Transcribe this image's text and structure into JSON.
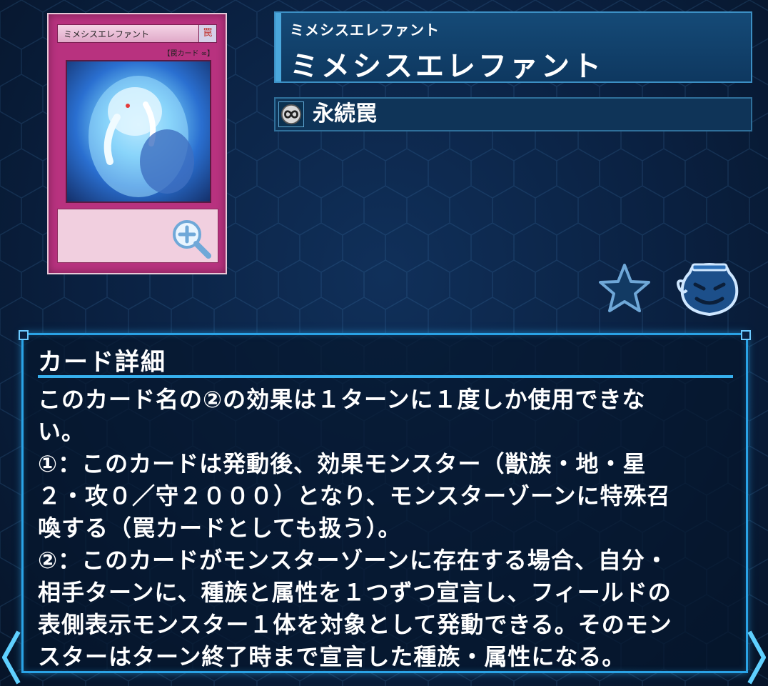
{
  "card_image": {
    "name_label": "ミメシスエレファント",
    "type_label": "【罠カード ∞】",
    "attribute_glyph": "罠",
    "zoom_icon": "zoom-in-icon"
  },
  "header": {
    "ruby": "ミメシスエレファント",
    "name": "ミメシスエレファント"
  },
  "type_row": {
    "icon": "continuous-infinity-icon",
    "label": "永続罠"
  },
  "actions": {
    "favorite_icon": "star-icon",
    "deck_icon": "pot-of-greed-icon"
  },
  "details": {
    "heading": "カード詳細",
    "text": "このカード名の②の効果は１ターンに１度しか使用できな\nい。\n①：このカードは発動後、効果モンスター（獣族・地・星\n２・攻０／守２０００）となり、モンスターゾーンに特殊召\n喚する（罠カードとしても扱う）。\n②：このカードがモンスターゾーンに存在する場合、自分・\n相手ターンに、種族と属性を１つずつ宣言し、フィールドの\n表側表示モンスター１体を対象として発動できる。そのモン\nスターはターン終了時まで宣言した種族・属性になる。"
  },
  "colors": {
    "accent": "#2aa3e6",
    "trap_frame": "#b8327f",
    "background": "#0a2040"
  }
}
